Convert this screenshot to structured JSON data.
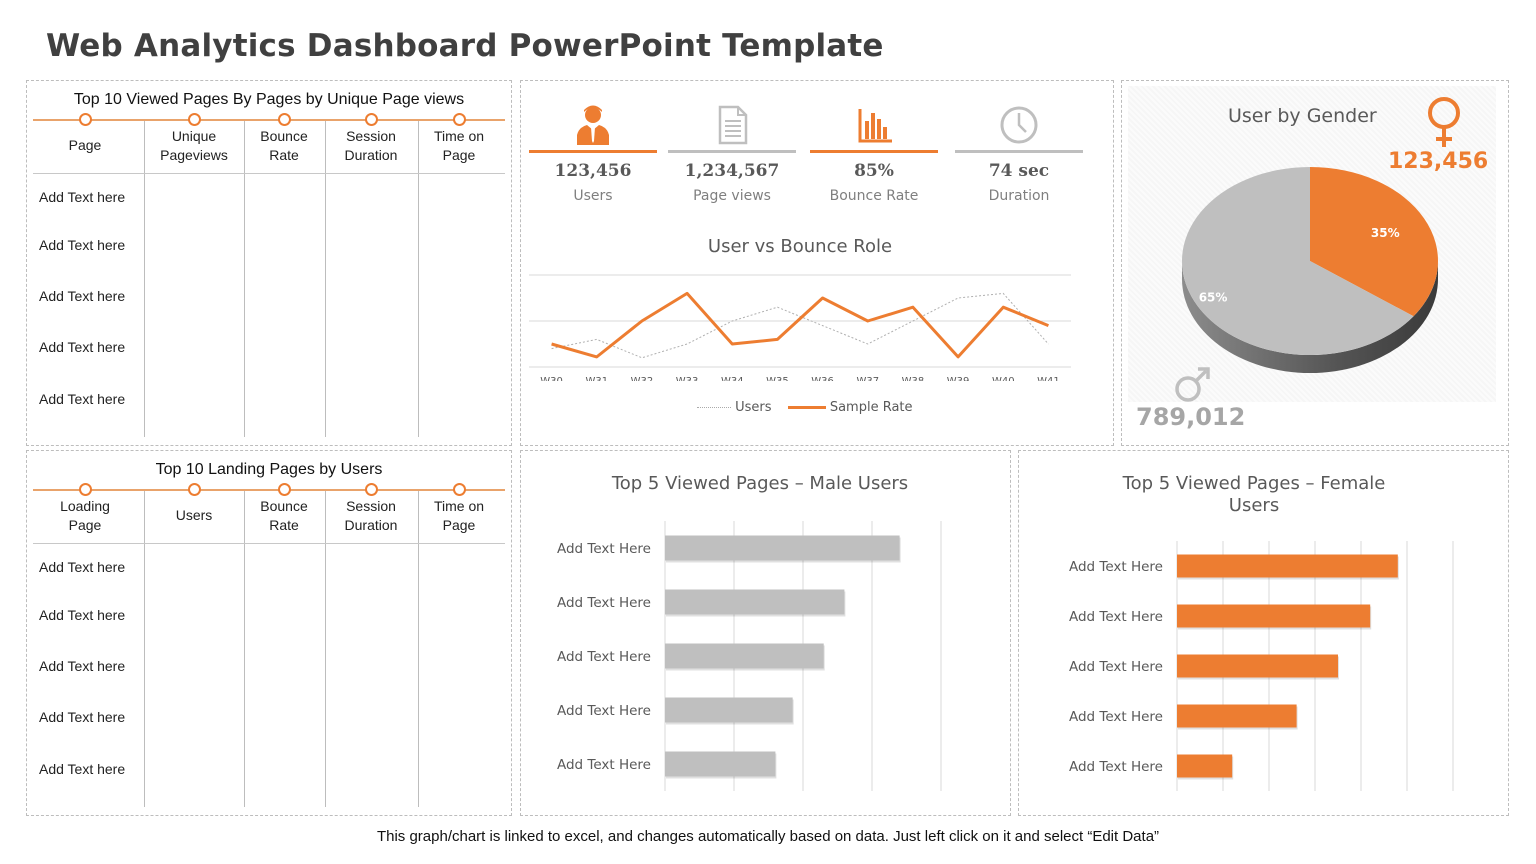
{
  "page": {
    "title": "Web Analytics Dashboard PowerPoint Template",
    "footer": "This graph/chart is linked  to excel, and changes automatically based on data. Just left click on it and select “Edit Data”"
  },
  "colors": {
    "accent": "#ed7d31",
    "neutral": "#bfbfbf",
    "text": "#595959"
  },
  "top10_viewed": {
    "title": "Top 10 Viewed Pages By Pages by Unique Page views",
    "columns": [
      "Page",
      "Unique\nPageviews",
      "Bounce\nRate",
      "Session\nDuration",
      "Time on\nPage"
    ],
    "rows": [
      "Add Text here",
      "Add Text here",
      "Add Text here",
      "Add Text here",
      "Add Text here"
    ]
  },
  "top10_landing": {
    "title": "Top 10 Landing Pages by Users",
    "columns": [
      "Loading\nPage",
      "Users",
      "Bounce\nRate",
      "Session\nDuration",
      "Time on\nPage"
    ],
    "rows": [
      "Add Text here",
      "Add Text here",
      "Add Text here",
      "Add Text here",
      "Add Text here"
    ]
  },
  "kpis": [
    {
      "icon": "user-icon",
      "value": "123,456",
      "label": "Users",
      "highlight": true
    },
    {
      "icon": "document-icon",
      "value": "1,234,567",
      "label": "Page  views",
      "highlight": false
    },
    {
      "icon": "bar-chart-icon",
      "value": "85%",
      "label": "Bounce Rate",
      "highlight": true
    },
    {
      "icon": "clock-icon",
      "value": "74 sec",
      "label": "Duration",
      "highlight": false
    }
  ],
  "gender": {
    "title": "User by Gender",
    "female_count": "123,456",
    "male_count": "789,012"
  },
  "chart_data": [
    {
      "type": "line",
      "title": "User vs Bounce Role",
      "categories": [
        "W30",
        "W31",
        "W32",
        "W33",
        "W34",
        "W35",
        "W36",
        "W37",
        "W38",
        "W39",
        "W40",
        "W41"
      ],
      "series": [
        {
          "name": "Users",
          "style": "dotted",
          "color": "#bfbfbf",
          "values": [
            0.4,
            0.6,
            0.2,
            0.5,
            1.0,
            1.3,
            0.9,
            0.5,
            1.0,
            1.5,
            1.6,
            0.5
          ]
        },
        {
          "name": "Sample Rate",
          "style": "solid",
          "color": "#ed7d31",
          "values": [
            0.5,
            0.22,
            1.0,
            1.6,
            0.5,
            0.6,
            1.5,
            1.0,
            1.3,
            0.22,
            1.3,
            0.9
          ]
        }
      ],
      "ylim": [
        0,
        2
      ],
      "grid": true,
      "legend": "bottom"
    },
    {
      "type": "pie",
      "title": "User by Gender",
      "categories": [
        "Female",
        "Male"
      ],
      "values": [
        35,
        65
      ],
      "labels": [
        "35%",
        "65%"
      ],
      "colors": [
        "#ed7d31",
        "#bfbfbf"
      ]
    },
    {
      "type": "bar",
      "orientation": "horizontal",
      "title": "Top 5 Viewed Pages – Male Users",
      "categories": [
        "Add Text Here",
        "Add Text Here",
        "Add Text Here",
        "Add Text Here",
        "Add Text Here"
      ],
      "values": [
        3.4,
        2.6,
        2.3,
        1.85,
        1.6
      ],
      "xlim": [
        0,
        4
      ],
      "grid": true,
      "color": "#bfbfbf"
    },
    {
      "type": "bar",
      "orientation": "horizontal",
      "title": "Top 5 Viewed Pages – Female Users",
      "categories": [
        "Add Text Here",
        "Add Text Here",
        "Add Text Here",
        "Add Text Here",
        "Add Text Here"
      ],
      "values": [
        4.8,
        4.2,
        3.5,
        2.6,
        1.2
      ],
      "xlim": [
        0,
        6
      ],
      "grid": true,
      "color": "#ed7d31"
    }
  ]
}
